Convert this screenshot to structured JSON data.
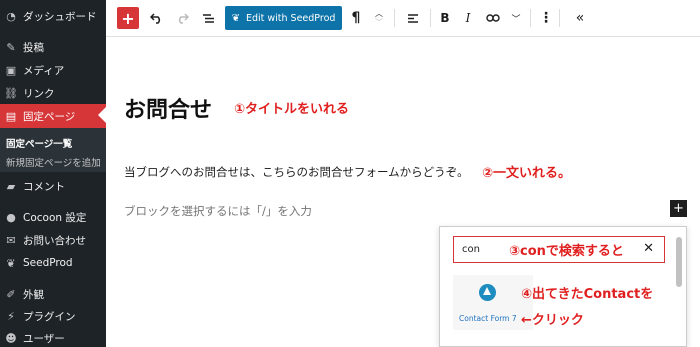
{
  "sidebar": {
    "items": [
      {
        "label": "ダッシュボード",
        "icon": "dashboard-icon"
      },
      {
        "label": "投稿",
        "icon": "pin-icon"
      },
      {
        "label": "メディア",
        "icon": "media-icon"
      },
      {
        "label": "リンク",
        "icon": "link-icon"
      },
      {
        "label": "固定ページ",
        "icon": "pages-icon"
      },
      {
        "label": "コメント",
        "icon": "comment-icon"
      },
      {
        "label": "Cocoon 設定",
        "icon": "cocoon-icon"
      },
      {
        "label": "お問い合わせ",
        "icon": "mail-icon"
      },
      {
        "label": "SeedProd",
        "icon": "seedprod-icon"
      },
      {
        "label": "外観",
        "icon": "appearance-icon"
      },
      {
        "label": "プラグイン",
        "icon": "plugin-icon"
      },
      {
        "label": "ユーザー",
        "icon": "user-icon"
      }
    ],
    "submenu": [
      "固定ページ一覧",
      "新規固定ページを追加"
    ]
  },
  "toolbar": {
    "seedprod_label": "Edit with SeedProd",
    "paragraph_glyph": "¶",
    "bold_glyph": "B",
    "italic_glyph": "I"
  },
  "content": {
    "title": "お問合せ",
    "paragraph": "当ブログへのお問合せは、こちらのお問合せフォームからどうぞ。",
    "placeholder": "ブロックを選択するには「/」を入力"
  },
  "inserter": {
    "search_value": "con",
    "result_label": "Contact Form 7"
  },
  "annotations": {
    "a1": "①タイトルをいれる",
    "a2": "②一文いれる。",
    "a3": "③conで検索すると",
    "a4": "④出てきたContactを",
    "a5": "←クリック"
  },
  "colors": {
    "accent": "#d63638",
    "annotation": "#e02020",
    "seedprod": "#0d73a8",
    "sidebar": "#1d2327"
  }
}
